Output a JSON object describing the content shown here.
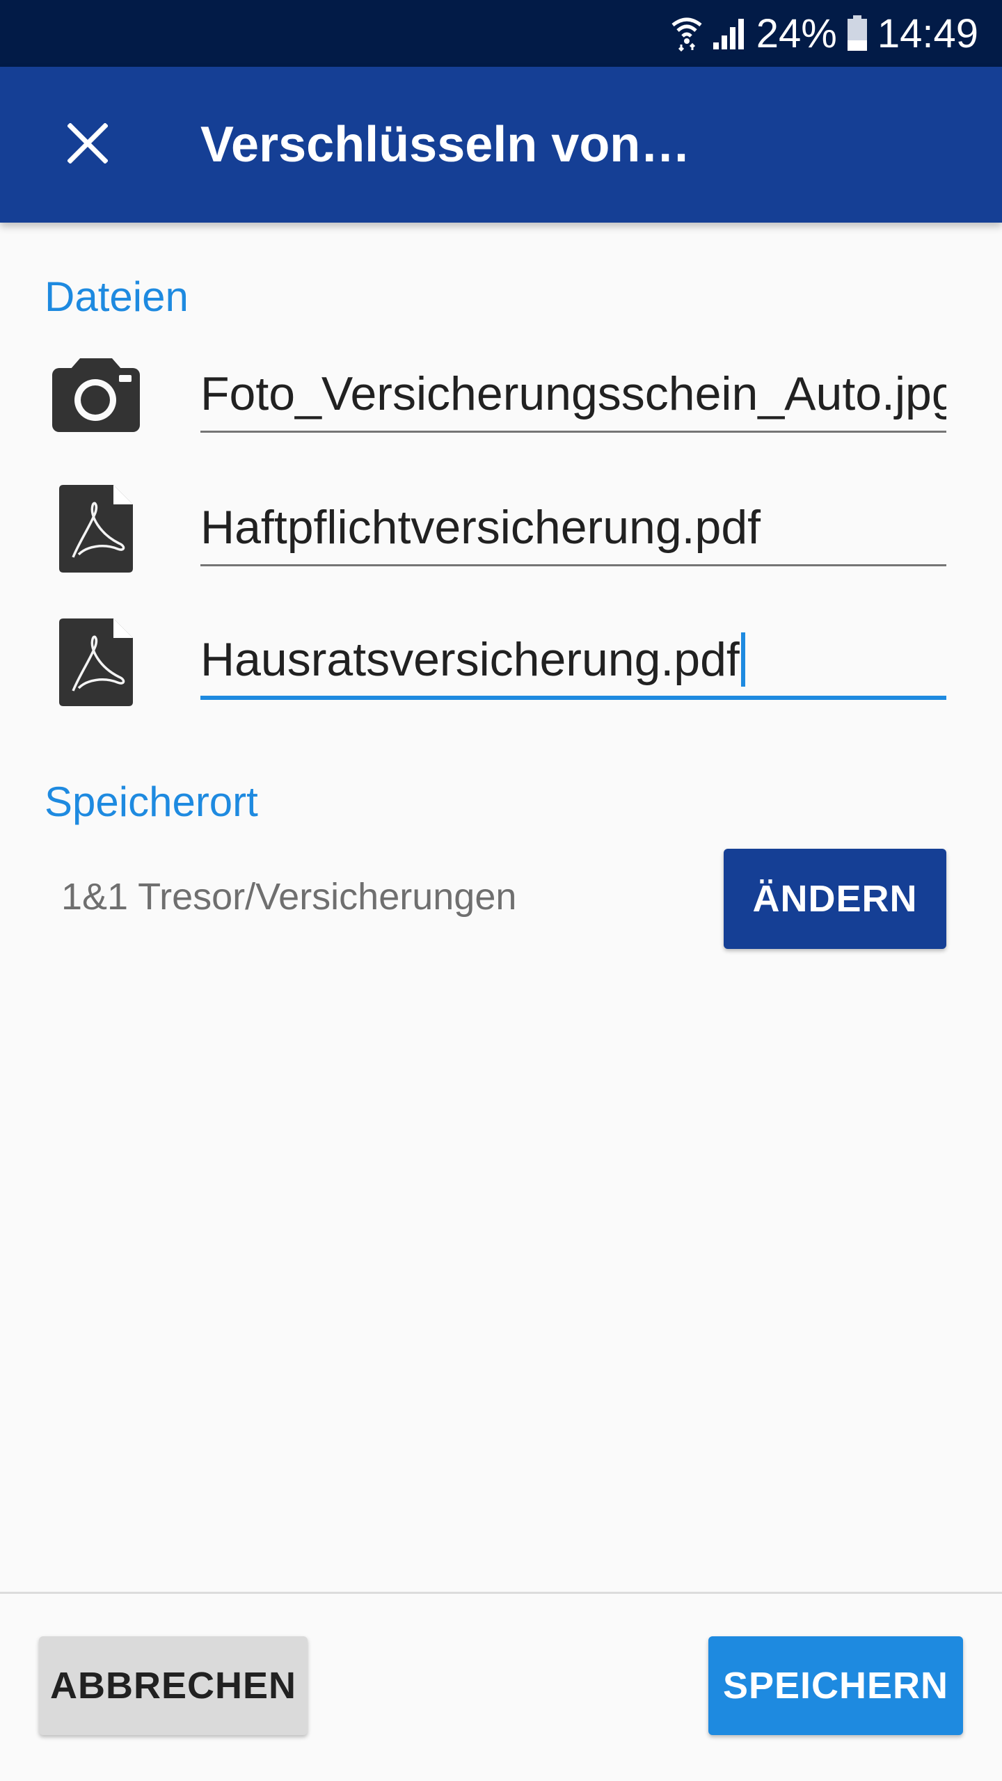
{
  "status_bar": {
    "battery": "24%",
    "time": "14:49",
    "icons": [
      "wifi-icon",
      "signal-icon",
      "battery-icon"
    ]
  },
  "app_bar": {
    "title": "Verschlüsseln von…",
    "close_icon": "close-icon"
  },
  "files": {
    "heading": "Dateien",
    "items": [
      {
        "icon": "camera-icon",
        "name": "Foto_Versicherungsschein_Auto.jpg"
      },
      {
        "icon": "pdf-file-icon",
        "name": "Haftpflichtversicherung.pdf"
      },
      {
        "icon": "pdf-file-icon",
        "name": "Hausratsversicherung.pdf"
      }
    ]
  },
  "location": {
    "heading": "Speicherort",
    "path": "1&1 Tresor/Versicherungen",
    "change_label": "ÄNDERN"
  },
  "actions": {
    "cancel_label": "ABBRECHEN",
    "save_label": "SPEICHERN"
  },
  "colors": {
    "status_bar": "#021b47",
    "app_bar": "#153f95",
    "accent": "#1e8ae0",
    "background": "#fafafa"
  }
}
